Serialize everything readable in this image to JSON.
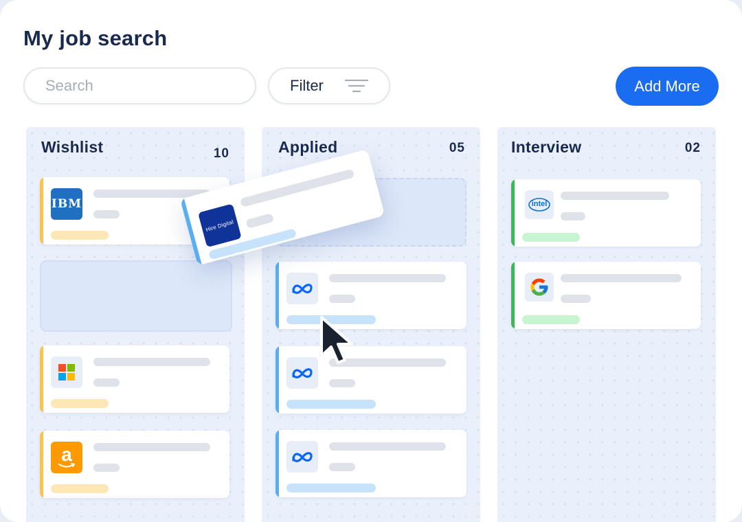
{
  "header": {
    "title": "My job search"
  },
  "toolbar": {
    "search_placeholder": "Search",
    "filter_label": "Filter",
    "add_label": "Add More"
  },
  "colors": {
    "accent_blue": "#1a6cf0",
    "wishlist_accent": "#f9c44e",
    "applied_accent": "#5aaeef",
    "interview_accent": "#3cb85a",
    "wishlist_pill": "#fde7b7",
    "applied_pill": "#c6e3fb",
    "interview_pill": "#c7f5d2"
  },
  "columns": [
    {
      "title": "Wishlist",
      "count": "10",
      "cards": [
        {
          "company": "ibm-logo",
          "logo_text": "IBM"
        },
        {
          "company": "microsoft-logo"
        },
        {
          "company": "amazon-logo",
          "logo_text": "a"
        }
      ]
    },
    {
      "title": "Applied",
      "count": "05",
      "cards": [
        {
          "company": "meta-logo"
        },
        {
          "company": "meta-logo"
        },
        {
          "company": "meta-logo"
        }
      ]
    },
    {
      "title": "Interview",
      "count": "02",
      "cards": [
        {
          "company": "intel-logo",
          "logo_text": "intel"
        },
        {
          "company": "google-logo",
          "logo_text": "G"
        }
      ]
    }
  ],
  "dragging_card": {
    "company": "hire-digital-logo",
    "logo_text": "Hire Digital"
  }
}
